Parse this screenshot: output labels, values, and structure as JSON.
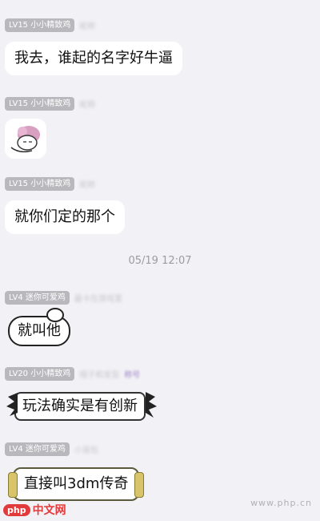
{
  "messages": [
    {
      "level": "LV15",
      "group_name": "小小精致鸡",
      "nickname": "昵称",
      "text": "我去，谁起的名字好牛逼"
    },
    {
      "level": "LV15",
      "group_name": "小小精致鸡",
      "nickname": "昵称",
      "sticker": "anime-face-sticker"
    },
    {
      "level": "LV15",
      "group_name": "小小精致鸡",
      "nickname": "昵称",
      "text": "就你们定的那个"
    },
    {
      "level": "LV4",
      "group_name": "迷你可爱鸡",
      "nickname": "最卡在游戏里",
      "text": "就叫他"
    },
    {
      "level": "LV20",
      "group_name": "小小精致鸡",
      "nickname": "帽子和发型",
      "title": "称号",
      "text": "玩法确实是有创新"
    },
    {
      "level": "LV4",
      "group_name": "迷你可爱鸡",
      "nickname": "小笼包",
      "text": "直接叫3dm传奇"
    }
  ],
  "timestamp": "05/19 12:07",
  "watermark": {
    "logo": "php",
    "text": "中文网"
  },
  "watermark_right": "www.php.cn"
}
